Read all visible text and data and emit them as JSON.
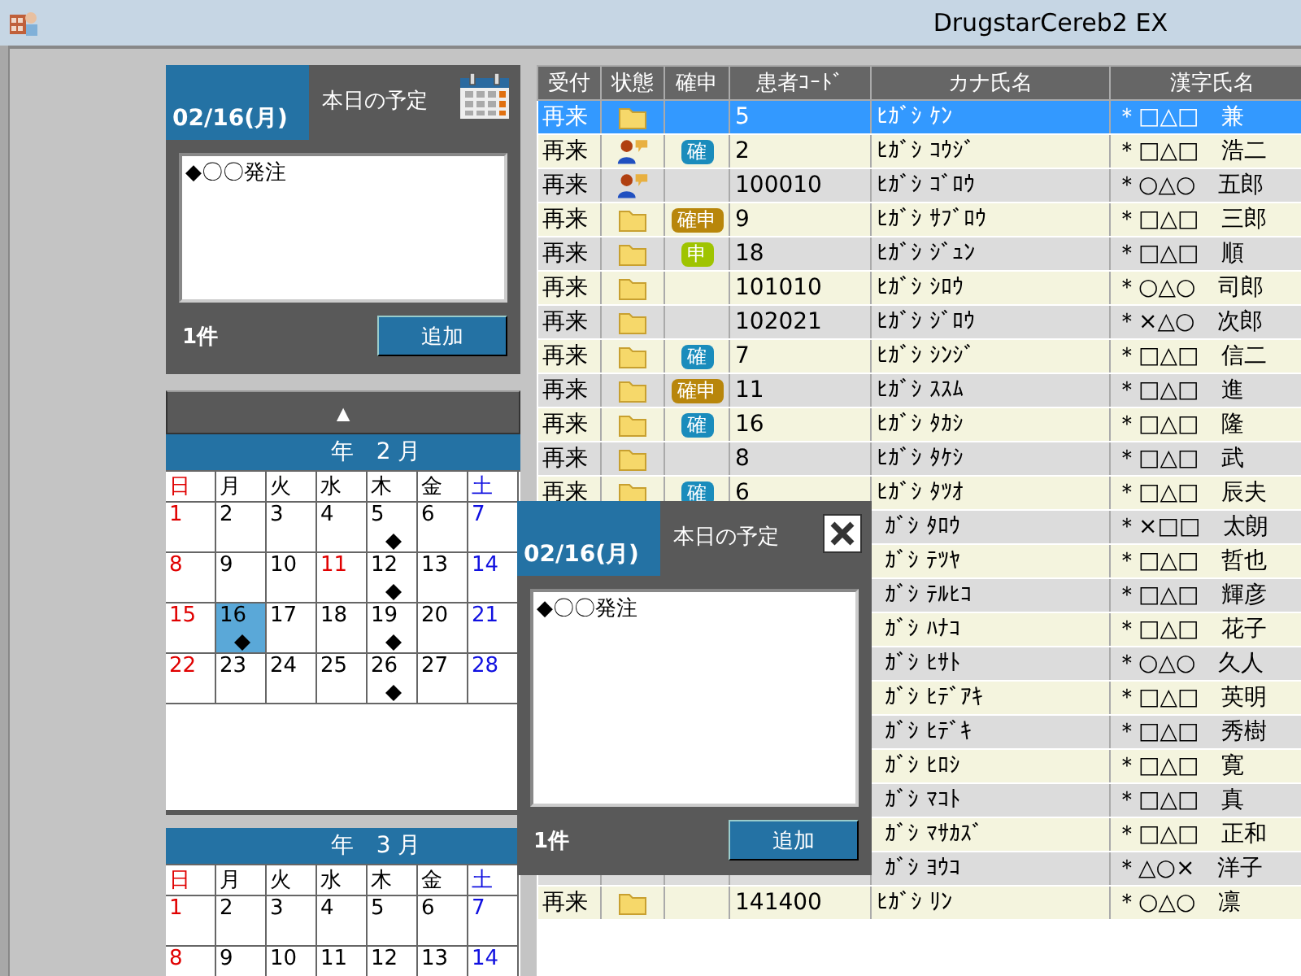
{
  "window": {
    "title": "DrugstarCereb2 EX"
  },
  "schedule_panel": {
    "date": "02/16(月)",
    "title": "本日の予定",
    "memo": "◆〇〇発注",
    "count": "1件",
    "add_button": "追加"
  },
  "scroll_up_button": "▲",
  "calendars": [
    {
      "title": "年　2 月",
      "weekdays": [
        {
          "label": "日",
          "kind": "sun"
        },
        {
          "label": "月",
          "kind": "normal"
        },
        {
          "label": "火",
          "kind": "normal"
        },
        {
          "label": "水",
          "kind": "normal"
        },
        {
          "label": "木",
          "kind": "normal"
        },
        {
          "label": "金",
          "kind": "normal"
        },
        {
          "label": "土",
          "kind": "sat"
        }
      ],
      "weeks": [
        [
          {
            "day": "1",
            "kind": "sun",
            "marked": false,
            "selected": false
          },
          {
            "day": "2",
            "kind": "normal",
            "marked": false,
            "selected": false
          },
          {
            "day": "3",
            "kind": "normal",
            "marked": false,
            "selected": false
          },
          {
            "day": "4",
            "kind": "normal",
            "marked": false,
            "selected": false
          },
          {
            "day": "5",
            "kind": "normal",
            "marked": true,
            "selected": false
          },
          {
            "day": "6",
            "kind": "normal",
            "marked": false,
            "selected": false
          },
          {
            "day": "7",
            "kind": "sat",
            "marked": false,
            "selected": false
          }
        ],
        [
          {
            "day": "8",
            "kind": "sun",
            "marked": false,
            "selected": false
          },
          {
            "day": "9",
            "kind": "normal",
            "marked": false,
            "selected": false
          },
          {
            "day": "10",
            "kind": "normal",
            "marked": false,
            "selected": false
          },
          {
            "day": "11",
            "kind": "holiday",
            "marked": false,
            "selected": false
          },
          {
            "day": "12",
            "kind": "normal",
            "marked": true,
            "selected": false
          },
          {
            "day": "13",
            "kind": "normal",
            "marked": false,
            "selected": false
          },
          {
            "day": "14",
            "kind": "sat",
            "marked": false,
            "selected": false
          }
        ],
        [
          {
            "day": "15",
            "kind": "sun",
            "marked": false,
            "selected": false
          },
          {
            "day": "16",
            "kind": "normal",
            "marked": true,
            "selected": true
          },
          {
            "day": "17",
            "kind": "normal",
            "marked": false,
            "selected": false
          },
          {
            "day": "18",
            "kind": "normal",
            "marked": false,
            "selected": false
          },
          {
            "day": "19",
            "kind": "normal",
            "marked": true,
            "selected": false
          },
          {
            "day": "20",
            "kind": "normal",
            "marked": false,
            "selected": false
          },
          {
            "day": "21",
            "kind": "sat",
            "marked": false,
            "selected": false
          }
        ],
        [
          {
            "day": "22",
            "kind": "sun",
            "marked": false,
            "selected": false
          },
          {
            "day": "23",
            "kind": "normal",
            "marked": false,
            "selected": false
          },
          {
            "day": "24",
            "kind": "normal",
            "marked": false,
            "selected": false
          },
          {
            "day": "25",
            "kind": "normal",
            "marked": false,
            "selected": false
          },
          {
            "day": "26",
            "kind": "normal",
            "marked": true,
            "selected": false
          },
          {
            "day": "27",
            "kind": "normal",
            "marked": false,
            "selected": false
          },
          {
            "day": "28",
            "kind": "sat",
            "marked": false,
            "selected": false
          }
        ]
      ]
    },
    {
      "title": "年　3 月",
      "weekdays": [
        {
          "label": "日",
          "kind": "sun"
        },
        {
          "label": "月",
          "kind": "normal"
        },
        {
          "label": "火",
          "kind": "normal"
        },
        {
          "label": "水",
          "kind": "normal"
        },
        {
          "label": "木",
          "kind": "normal"
        },
        {
          "label": "金",
          "kind": "normal"
        },
        {
          "label": "土",
          "kind": "sat"
        }
      ],
      "weeks": [
        [
          {
            "day": "1",
            "kind": "sun",
            "marked": false,
            "selected": false
          },
          {
            "day": "2",
            "kind": "normal",
            "marked": false,
            "selected": false
          },
          {
            "day": "3",
            "kind": "normal",
            "marked": false,
            "selected": false
          },
          {
            "day": "4",
            "kind": "normal",
            "marked": false,
            "selected": false
          },
          {
            "day": "5",
            "kind": "normal",
            "marked": false,
            "selected": false
          },
          {
            "day": "6",
            "kind": "normal",
            "marked": false,
            "selected": false
          },
          {
            "day": "7",
            "kind": "sat",
            "marked": false,
            "selected": false
          }
        ],
        [
          {
            "day": "8",
            "kind": "sun",
            "marked": false,
            "selected": false
          },
          {
            "day": "9",
            "kind": "normal",
            "marked": false,
            "selected": false
          },
          {
            "day": "10",
            "kind": "normal",
            "marked": false,
            "selected": false
          },
          {
            "day": "11",
            "kind": "normal",
            "marked": false,
            "selected": false
          },
          {
            "day": "12",
            "kind": "normal",
            "marked": false,
            "selected": false
          },
          {
            "day": "13",
            "kind": "normal",
            "marked": false,
            "selected": false
          },
          {
            "day": "14",
            "kind": "sat",
            "marked": false,
            "selected": false
          }
        ]
      ]
    }
  ],
  "table": {
    "columns": [
      "受付",
      "状態",
      "確申",
      "患者ｺｰﾄﾞ",
      "カナ氏名",
      "漢字氏名"
    ],
    "rows": [
      {
        "reception": "再来",
        "status": {
          "kind": "folder"
        },
        "code": "5",
        "kana": "ﾋｶﾞｼ ｹﾝ",
        "kanji": "＊□△□　兼",
        "selected": true
      },
      {
        "reception": "再来",
        "status": {
          "kind": "person"
        },
        "confirm": {
          "label": "確",
          "kind": "confirmed"
        },
        "code": "2",
        "kana": "ﾋｶﾞｼ ｺｳｼﾞ",
        "kanji": "＊□△□　浩二",
        "selected": false
      },
      {
        "reception": "再来",
        "status": {
          "kind": "person"
        },
        "code": "100010",
        "kana": "ﾋｶﾞｼ ｺﾞﾛｳ",
        "kanji": "＊○△○　五郎",
        "selected": false
      },
      {
        "reception": "再来",
        "status": {
          "kind": "folder"
        },
        "confirm": {
          "label": "確申",
          "kind": "both"
        },
        "code": "9",
        "kana": "ﾋｶﾞｼ ｻﾌﾞﾛｳ",
        "kanji": "＊□△□　三郎",
        "selected": false
      },
      {
        "reception": "再来",
        "status": {
          "kind": "folder"
        },
        "confirm": {
          "label": "申",
          "kind": "applied"
        },
        "code": "18",
        "kana": "ﾋｶﾞｼ ｼﾞｭﾝ",
        "kanji": "＊□△□　順",
        "selected": false
      },
      {
        "reception": "再来",
        "status": {
          "kind": "folder"
        },
        "code": "101010",
        "kana": "ﾋｶﾞｼ ｼﾛｳ",
        "kanji": "＊○△○　司郎",
        "selected": false
      },
      {
        "reception": "再来",
        "status": {
          "kind": "folder"
        },
        "code": "102021",
        "kana": "ﾋｶﾞｼ ｼﾞﾛｳ",
        "kanji": "＊×△○　次郎",
        "selected": false
      },
      {
        "reception": "再来",
        "status": {
          "kind": "folder"
        },
        "confirm": {
          "label": "確",
          "kind": "confirmed"
        },
        "code": "7",
        "kana": "ﾋｶﾞｼ ｼﾝｼﾞ",
        "kanji": "＊□△□　信二",
        "selected": false
      },
      {
        "reception": "再来",
        "status": {
          "kind": "folder"
        },
        "confirm": {
          "label": "確申",
          "kind": "both"
        },
        "code": "11",
        "kana": "ﾋｶﾞｼ ｽｽﾑ",
        "kanji": "＊□△□　進",
        "selected": false
      },
      {
        "reception": "再来",
        "status": {
          "kind": "folder"
        },
        "confirm": {
          "label": "確",
          "kind": "confirmed"
        },
        "code": "16",
        "kana": "ﾋｶﾞｼ ﾀｶｼ",
        "kanji": "＊□△□　隆",
        "selected": false
      },
      {
        "reception": "再来",
        "status": {
          "kind": "folder"
        },
        "code": "8",
        "kana": "ﾋｶﾞｼ ﾀｹｼ",
        "kanji": "＊□△□　武",
        "selected": false
      },
      {
        "reception": "再来",
        "status": {
          "kind": "folder"
        },
        "confirm": {
          "label": "確",
          "kind": "confirmed"
        },
        "code": "6",
        "kana": "ﾋｶﾞｼ ﾀﾂｵ",
        "kanji": "＊□△□　辰夫",
        "selected": false
      },
      {
        "kana": "ｶﾞｼ ﾀﾛｳ",
        "kanji": "＊×□□　太朗",
        "selected": false
      },
      {
        "kana": "ｶﾞｼ ﾃﾂﾔ",
        "kanji": "＊□△□　哲也",
        "selected": false
      },
      {
        "kana": "ｶﾞｼ ﾃﾙﾋｺ",
        "kanji": "＊□△□　輝彦",
        "selected": false
      },
      {
        "kana": "ｶﾞｼ ﾊﾅｺ",
        "kanji": "＊□△□　花子",
        "selected": false
      },
      {
        "kana": "ｶﾞｼ ﾋｻﾄ",
        "kanji": "＊○△○　久人",
        "selected": false
      },
      {
        "kana": "ｶﾞｼ ﾋﾃﾞｱｷ",
        "kanji": "＊□△□　英明",
        "selected": false
      },
      {
        "kana": "ｶﾞｼ ﾋﾃﾞｷ",
        "kanji": "＊□△□　秀樹",
        "selected": false
      },
      {
        "kana": "ｶﾞｼ ﾋﾛｼ",
        "kanji": "＊□△□　寛",
        "selected": false
      },
      {
        "kana": "ｶﾞｼ ﾏｺﾄ",
        "kanji": "＊□△□　真",
        "selected": false
      },
      {
        "kana": "ｶﾞｼ ﾏｻｶｽﾞ",
        "kanji": "＊□△□　正和",
        "selected": false
      },
      {
        "kana": "ｶﾞｼ ﾖｳｺ",
        "kanji": "＊△○×　洋子",
        "selected": false
      },
      {
        "reception": "再来",
        "status": {
          "kind": "folder"
        },
        "code": "141400",
        "kana": "ﾋｶﾞｼ ﾘﾝ",
        "kanji": "＊○△○　凛",
        "selected": false
      }
    ]
  },
  "popup": {
    "date": "02/16(月)",
    "title": "本日の予定",
    "memo": "◆〇〇発注",
    "count": "1件",
    "add_button": "追加"
  }
}
